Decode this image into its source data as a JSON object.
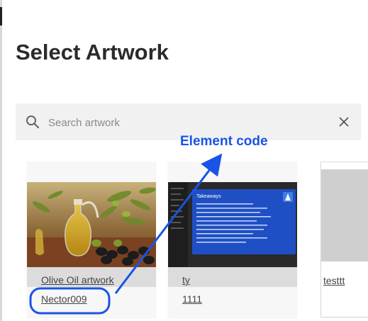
{
  "dialog": {
    "title": "Select Artwork"
  },
  "search": {
    "placeholder": "Search artwork"
  },
  "annotation": {
    "label": "Element code",
    "color": "#1a53e6"
  },
  "artworks": [
    {
      "name": "Olive Oil artwork",
      "code": "Nector009"
    },
    {
      "name": "ty",
      "code": "1111"
    },
    {
      "name": "testtt"
    }
  ],
  "slide_thumbnail": {
    "heading": "Takeaways",
    "accent": "#1f4fc4"
  }
}
